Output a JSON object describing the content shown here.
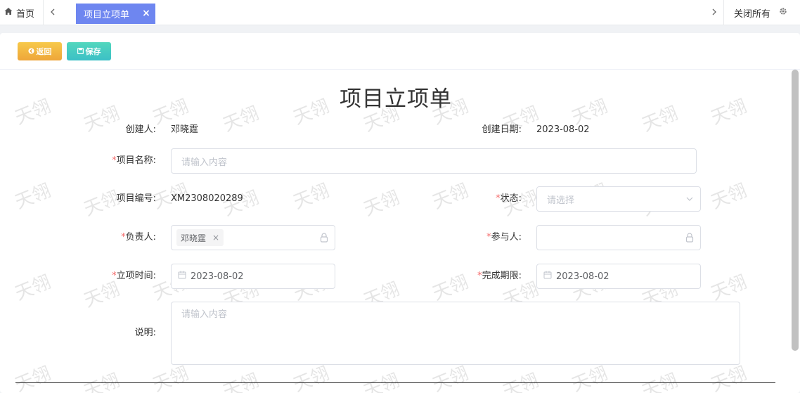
{
  "tabbar": {
    "home_label": "首页",
    "active_tab_label": "项目立项单",
    "active_tab_close": "×",
    "close_all_label": "关闭所有",
    "scroll_left": "‹",
    "scroll_right": "›"
  },
  "toolbar": {
    "back_label": "返回",
    "save_label": "保存",
    "back_color": "#f0ad3c",
    "save_color": "#3fc6c0"
  },
  "watermark_text": "天翎",
  "form": {
    "title": "项目立项单",
    "creator_label": "创建人:",
    "creator_value": "邓晓霆",
    "create_date_label": "创建日期:",
    "create_date_value": "2023-08-02",
    "project_name_label": "项目名称:",
    "project_name_placeholder": "请输入内容",
    "project_no_label": "项目编号:",
    "project_no_value": "XM2308020289",
    "status_label": "状态:",
    "status_placeholder": "请选择",
    "owner_label": "负责人:",
    "owner_tag": "邓晓霆",
    "owner_tag_close": "×",
    "participants_label": "参与人:",
    "start_date_label": "立项时间:",
    "start_date_value": "2023-08-02",
    "deadline_label": "完成期限:",
    "deadline_value": "2023-08-02",
    "description_label": "说明:",
    "description_placeholder": "请输入内容",
    "required_mark": "*"
  },
  "colors": {
    "accent": "#6e86f0",
    "required": "#f56c6c",
    "border": "#dcdfe6"
  }
}
